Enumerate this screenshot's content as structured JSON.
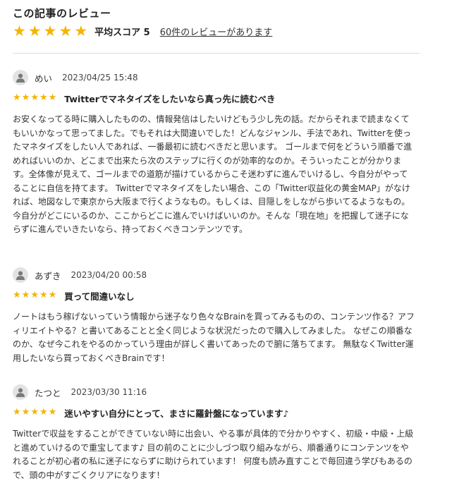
{
  "section_title": "この記事のレビュー",
  "summary": {
    "stars": 5,
    "average_label": "平均スコア 5",
    "review_count_link": "60件のレビューがあります"
  },
  "colors": {
    "star": "#f5b400",
    "avatar_bg": "#e3e3e3",
    "divider": "#dddddd"
  },
  "reviews": [
    {
      "user": "めい",
      "date": "2023/04/25 15:48",
      "stars": 5,
      "title": "Twitterでマネタイズをしたいなら真っ先に読むべき",
      "body": "お安くなってる時に購入したものの、情報発信はしたいけどもう少し先の話。だからそれまで読まなくてもいいかなって思ってました。でもそれは大間違いでした！どんなジャンル、手法であれ、Twitterを使ったマネタイズをしたい人であれば、一番最初に読むべきだと思います。 ゴールまで何をどういう順番で進めればいいのか、どこまで出来たら次のステップに行くのが効率的なのか。そういったことが分かります。全体像が見えて、ゴールまでの道筋が描けているからこそ迷わずに進んでいけるし、今自分がやってることに自信を持てます。 Twitterでマネタイズをしたい場合、この「Twitter収益化の黄金MAP」がなければ、地図なしで東京から大阪まで行くようなもの。もしくは、目隠しをしながら歩いてるようなもの。今自分がどこにいるのか、ここからどこに進んでいけばいいのか。そんな「現在地」を把握して迷子にならずに進んでいきたいなら、持っておくべきコンテンツです。"
    },
    {
      "user": "あずき",
      "date": "2023/04/20 00:58",
      "stars": 5,
      "title": "買って間違いなし",
      "body": "ノートはもう稼げないっていう情報から迷子なり色々なBrainを買ってみるものの、コンテンツ作る？アフィリエイトやる？と書いてあることと全く同じような状況だったので購入してみました。 なぜこの順番なのか、なぜ今これをやるのかっていう理由が詳しく書いてあったので腑に落ちてます。 無駄なくTwitter運用したいなら買っておくべきBrainです！"
    },
    {
      "user": "たつと",
      "date": "2023/03/30 11:16",
      "stars": 5,
      "title": "迷いやすい自分にとって、まさに羅針盤になっています♪",
      "body": "Twitterで収益をすることができていない時に出会い、やる事が具体的で分かりやすく、初級・中級・上級と進めていけるので重宝してます♪ 目の前のことに少しづつ取り組みながら、順番通りにコンテンツをやれることが初心者の私に迷子にならずに助けられています！ 何度も読み直すことで毎回違う学びもあるので、頭の中がすごくクリアになります！"
    }
  ]
}
